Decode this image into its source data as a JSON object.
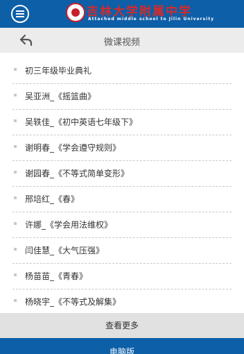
{
  "header": {
    "logo_cn": "吉林大学附属中学",
    "logo_en": "Attached middle school to Jilin University",
    "menu_icon": "menu-icon",
    "brand_color": "#0d5fa8"
  },
  "subbar": {
    "title": "微课视频",
    "back_icon": "back-arrow-icon"
  },
  "list": {
    "items": [
      {
        "label": "初三年级毕业典礼"
      },
      {
        "label": "吴亚洲_《摇篮曲》"
      },
      {
        "label": "吴轶佳_《初中英语七年级下》"
      },
      {
        "label": "谢明春_《学会遵守规则》"
      },
      {
        "label": "谢园春_《不等式简单变形》"
      },
      {
        "label": "邢培红_《春》"
      },
      {
        "label": "许娜_《学会用法维权》"
      },
      {
        "label": "闫佳慧_《大气压强》"
      },
      {
        "label": "杨苗苗_《青春》"
      },
      {
        "label": "杨晓宇_《不等式及解集》"
      }
    ]
  },
  "more": {
    "label": "查看更多"
  },
  "footer": {
    "label": "电脑版"
  }
}
